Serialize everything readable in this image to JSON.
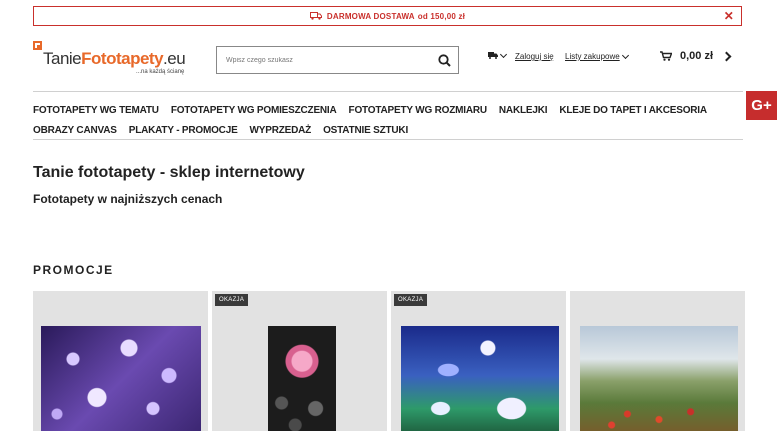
{
  "promo_bar": {
    "text": "DARMOWA DOSTAWA",
    "amount": "od 150,00 zł",
    "close": "✕"
  },
  "logo": {
    "prefix": "Tanie",
    "highlight": "Fototapety",
    "suffix": ".eu",
    "tagline": "...na każdą ścianę"
  },
  "search": {
    "placeholder": "Wpisz czego szukasz"
  },
  "topnav": {
    "login": "Zaloguj się",
    "shopping_lists": "Listy zakupowe"
  },
  "cart": {
    "total": "0,00 zł"
  },
  "social": {
    "gplus": "G+"
  },
  "mainnav": {
    "row1": [
      "FOTOTAPETY WG TEMATU",
      "FOTOTAPETY WG POMIESZCZENIA",
      "FOTOTAPETY WG ROZMIARU",
      "NAKLEJKI",
      "KLEJE DO TAPET I AKCESORIA"
    ],
    "row2": [
      "OBRAZY CANVAS",
      "PLAKATY - PROMOCJE",
      "WYPRZEDAŻ",
      "OSTATNIE SZTUKI"
    ]
  },
  "page": {
    "title": "Tanie fototapety - sklep internetowy",
    "subtitle": "Fototapety w najniższych cenach"
  },
  "promotions": {
    "heading": "PROMOCJE",
    "products": [
      {
        "badge": ""
      },
      {
        "badge": "OKAZJA"
      },
      {
        "badge": "OKAZJA"
      },
      {
        "badge": ""
      }
    ]
  },
  "colors": {
    "accent": "#c9302c",
    "logo_orange": "#e8692a",
    "gplus_red": "#c62d2d"
  }
}
